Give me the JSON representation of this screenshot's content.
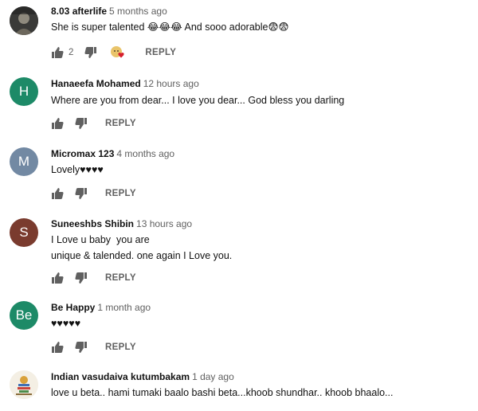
{
  "reply_label": "REPLY",
  "colors": {
    "avatar_green": "#1d8a67",
    "avatar_gray": "#7289a3",
    "avatar_brown": "#7a3b2e",
    "heart_red": "#d61f2c"
  },
  "icons": [
    "thumbs-up-icon",
    "thumbs-down-icon",
    "creator-heart-icon"
  ],
  "comments": [
    {
      "author": "8.03 afterlife",
      "time": "5 months ago",
      "avatar": "",
      "lines": [
        "She is super talented 😂😂😂 And sooo adorable😨😨"
      ],
      "likes": "2",
      "hearted": true
    },
    {
      "author": "Hanaeefa Mohamed",
      "time": "12 hours ago",
      "avatar": "H",
      "lines": [
        "Where are you from dear... I love you dear... God bless you darling"
      ],
      "likes": ""
    },
    {
      "author": "Micromax 123",
      "time": "4 months ago",
      "avatar": "M",
      "lines": [
        "Lovely♥♥♥♥"
      ],
      "likes": ""
    },
    {
      "author": "Suneeshbs Shibin",
      "time": "13 hours ago",
      "avatar": "S",
      "lines": [
        "I Love u baby  you are",
        "unique & talended. one again I Love you."
      ],
      "likes": ""
    },
    {
      "author": "Be Happy",
      "time": "1 month ago",
      "avatar": "Be",
      "lines": [
        "♥♥♥♥♥"
      ],
      "likes": ""
    },
    {
      "author": "Indian vasudaiva kutumbakam",
      "time": "1 day ago",
      "avatar": "",
      "lines": [
        "love u beta.. hami tumaki baalo bashi beta...khoob shundhar.. khoob bhaalo..."
      ],
      "likes": ""
    }
  ]
}
